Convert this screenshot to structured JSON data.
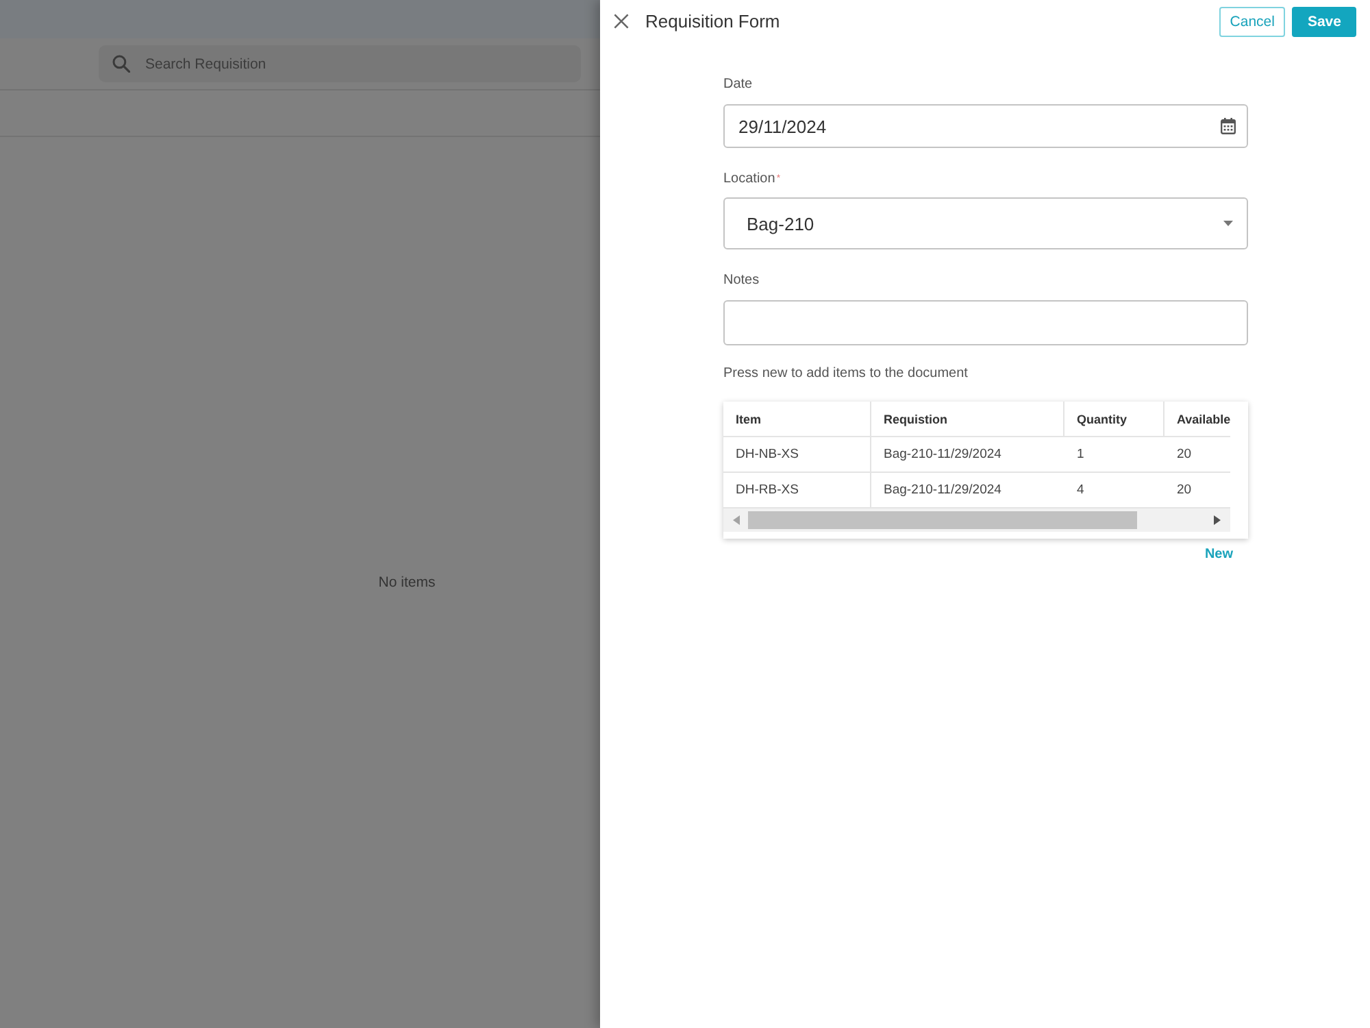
{
  "background_page": {
    "search": {
      "placeholder": "Search Requisition"
    },
    "empty_text": "No items"
  },
  "panel": {
    "title": "Requisition Form",
    "buttons": [
      {
        "label": "Cancel",
        "kind": "outline"
      },
      {
        "label": "Save",
        "kind": "primary"
      }
    ]
  },
  "form": {
    "fields": [
      {
        "label": "Date",
        "kind": "date",
        "value": "29/11/2024"
      },
      {
        "label": "Location",
        "required_mark": "*",
        "kind": "select",
        "value": "Bag-210"
      },
      {
        "label": "Notes",
        "kind": "text"
      }
    ],
    "hint": "Press new to add items to the document",
    "table": {
      "columns": [
        "Item",
        "Requistion",
        "Quantity",
        "Available"
      ],
      "rows": [
        [
          "DH-NB-XS",
          "Bag-210-11/29/2024",
          "1",
          "20"
        ],
        [
          "DH-RB-XS",
          "Bag-210-11/29/2024",
          "4",
          "20"
        ]
      ]
    },
    "new_button": "New"
  }
}
